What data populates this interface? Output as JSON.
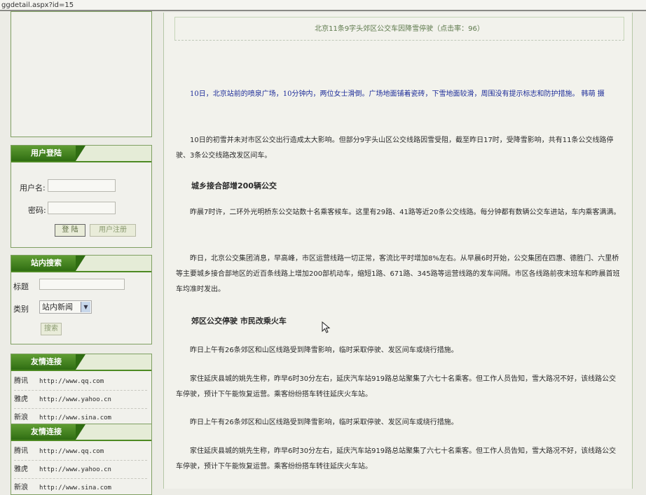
{
  "browser": {
    "url": "ggdetail.aspx?id=15"
  },
  "login": {
    "title": "用户登陆",
    "username_label": "用户名:",
    "password_label": "密码:",
    "login_button": "登 陆",
    "register_button": "用户注册"
  },
  "search": {
    "title": "站内搜索",
    "title_label": "标题",
    "category_label": "类别",
    "category_value": "站内新闻",
    "search_button": "搜索"
  },
  "links_1": {
    "title": "友情连接",
    "items": [
      {
        "name": "腾讯",
        "url": "http://www.qq.com"
      },
      {
        "name": "雅虎",
        "url": "http://www.yahoo.cn"
      },
      {
        "name": "新浪",
        "url": "http://www.sina.com"
      }
    ]
  },
  "links_2": {
    "title": "友情连接",
    "items": [
      {
        "name": "腾讯",
        "url": "http://www.qq.com"
      },
      {
        "name": "雅虎",
        "url": "http://www.yahoo.cn"
      },
      {
        "name": "新浪",
        "url": "http://www.sina.com"
      }
    ]
  },
  "article": {
    "title": "北京11条9字头郊区公交车因降雪停驶（点击率：96）",
    "caption": "10日，北京站前的喷泉广场，10分钟内，两位女士滑倒。广场地面铺着瓷砖，下雪地面较滑，周围没有提示标志和防护措施。 韩萌 摄",
    "p1": "10日的初雪并未对市区公交出行造成太大影响。但部分9字头山区公交线路因雪受阻，截至昨日17时，受降雪影响，共有11条公交线路停驶、3条公交线路改发区间车。",
    "h1": "城乡接合部增200辆公交",
    "p2": "昨晨7时许，二环外光明桥东公交站数十名乘客候车。这里有29路、41路等近20条公交线路。每分钟都有数辆公交车进站，车内乘客满满。",
    "p3": "昨日，北京公交集团消息，早高峰，市区运营线路一切正常，客流比平时增加8%左右。从早晨6时开始，公交集团在四惠、德胜门、六里桥等主要城乡接合部地区的近百条线路上增加200部机动车，缩短1路、671路、345路等运营线路的发车间隔。市区各线路前夜末班车和昨晨首班车均准时发出。",
    "h2": "郊区公交停驶 市民改乘火车",
    "p4": "昨日上午有26条郊区和山区线路受到降雪影响，临时采取停驶、发区间车或绕行措施。",
    "p5": "家住延庆县城的姚先生称，昨早6时30分左右，延庆汽车站919路总站聚集了六七十名乘客。但工作人员告知，雪大路况不好，该线路公交车停驶，预计下午能恢复运营。乘客纷纷搭车转往延庆火车站。",
    "p6": "昨日上午有26条郊区和山区线路受到降雪影响，临时采取停驶、发区间车或绕行措施。",
    "p7": "家住延庆县城的姚先生称，昨早6时30分左右，延庆汽车站919路总站聚集了六七十名乘客。但工作人员告知，雪大路况不好，该线路公交车停驶，预计下午能恢复运营。乘客纷纷搭车转往延庆火车站。"
  },
  "colors": {
    "accent": "#3f7d1a",
    "caption": "#1f2e9a"
  },
  "icons": {
    "cursor": "mouse-pointer-icon"
  }
}
